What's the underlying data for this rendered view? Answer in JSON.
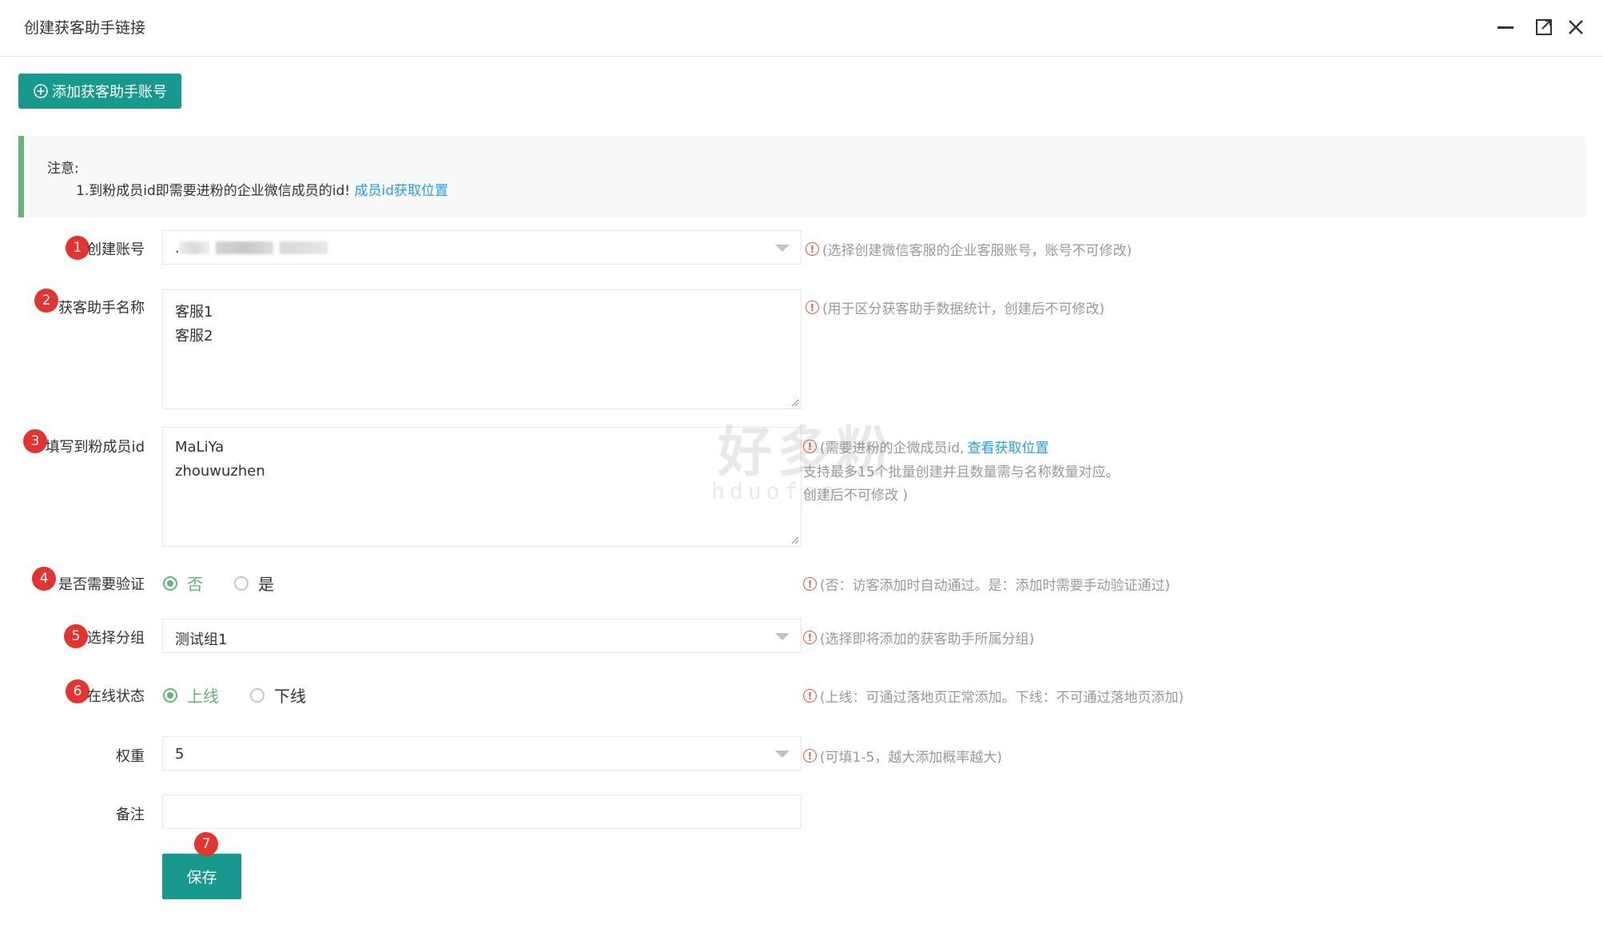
{
  "window": {
    "title": "创建获客助手链接",
    "minimize_icon": "minimize-icon",
    "maximize_icon": "maximize-icon",
    "close_icon": "close-icon"
  },
  "toolbar": {
    "add_button_label": "添加获客助手账号",
    "add_icon": "plus-circle-icon"
  },
  "notice": {
    "title": "注意:",
    "line_text": "1.到粉成员id即需要进粉的企业微信成员的id!",
    "line_link": "成员id获取位置"
  },
  "form": {
    "account": {
      "badge": "1",
      "label": "创建账号",
      "value_prefix": ".",
      "tip": "(选择创建微信客服的企业客服账号，账号不可修改)"
    },
    "assistant_name": {
      "badge": "2",
      "label": "获客助手名称",
      "lines": [
        "客服1",
        "客服2"
      ],
      "tip": "(用于区分获客助手数据统计，创建后不可修改)"
    },
    "member_id": {
      "badge": "3",
      "label": "填写到粉成员id",
      "lines": [
        "MaLiYa",
        "zhouwuzhen"
      ],
      "tip_prefix": "(需要进粉的企微成员id,",
      "tip_link": "查看获取位置",
      "tip_line2": "支持最多15个批量创建并且数量需与名称数量对应。",
      "tip_line3": "创建后不可修改 )"
    },
    "verify": {
      "badge": "4",
      "label": "是否需要验证",
      "options": [
        "否",
        "是"
      ],
      "selected": "否",
      "tip": "(否：访客添加时自动通过。是：添加时需要手动验证通过)"
    },
    "group": {
      "badge": "5",
      "label": "选择分组",
      "value": "测试组1",
      "tip": "(选择即将添加的获客助手所属分组)"
    },
    "status": {
      "badge": "6",
      "label": "在线状态",
      "options": [
        "上线",
        "下线"
      ],
      "selected": "上线",
      "tip": "(上线：可通过落地页正常添加。下线：不可通过落地页添加)"
    },
    "weight": {
      "label": "权重",
      "value": "5",
      "tip": "(可填1-5，越大添加概率越大)"
    },
    "remark": {
      "label": "备注",
      "value": ""
    },
    "save": {
      "badge": "7",
      "label": "保存"
    }
  },
  "watermark": {
    "main": "好多粉",
    "sub": "hduofen"
  },
  "colors": {
    "primary": "#17998d",
    "notice_border": "#5fb878",
    "badge": "#e3342f",
    "link": "#1e9fff",
    "tip_icon": "#e35b3f"
  }
}
